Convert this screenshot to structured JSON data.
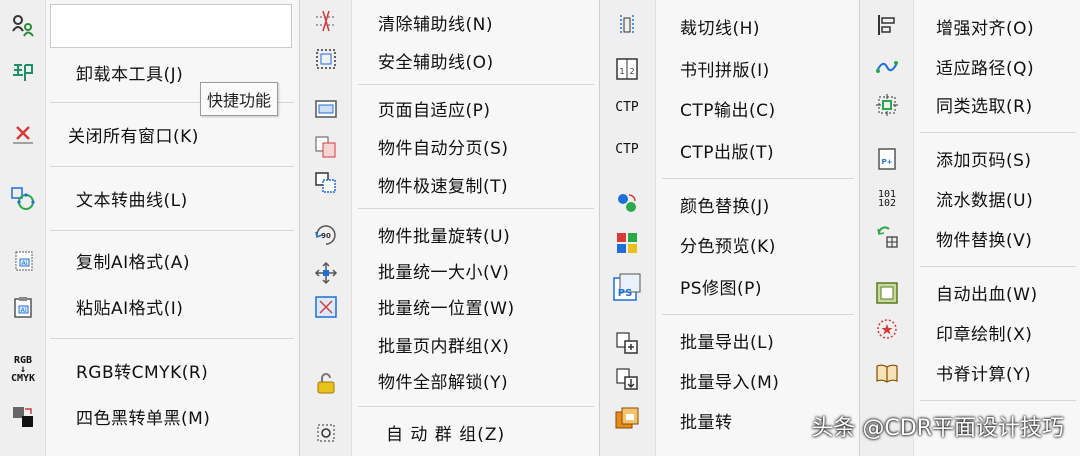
{
  "panel1": {
    "items": [
      {
        "label": "卸载本工具(J)"
      },
      {
        "label": "关闭所有窗口(K)"
      },
      {
        "label": "文本转曲线(L)"
      },
      {
        "label": "复制AI格式(A)"
      },
      {
        "label": "粘贴AI格式(I)"
      },
      {
        "label": "RGB转CMYK(R)"
      },
      {
        "label": "四色黑转单黑(M)"
      }
    ],
    "tooltip": "快捷功能",
    "rgb_icon_text": [
      "RGB",
      "↓",
      "CMYK"
    ]
  },
  "panel2": {
    "items": [
      {
        "label": "清除辅助线(N)"
      },
      {
        "label": "安全辅助线(O)"
      },
      {
        "label": "页面自适应(P)"
      },
      {
        "label": "物件自动分页(S)"
      },
      {
        "label": "物件极速复制(T)"
      },
      {
        "label": "物件批量旋转(U)"
      },
      {
        "label": "批量统一大小(V)"
      },
      {
        "label": "批量统一位置(W)"
      },
      {
        "label": "批量页内群组(X)"
      },
      {
        "label": "物件全部解锁(Y)"
      },
      {
        "label": "自 动 群 组(Z)"
      }
    ]
  },
  "panel3": {
    "items": [
      {
        "label": "裁切线(H)"
      },
      {
        "label": "书刊拼版(I)"
      },
      {
        "label": "CTP输出(C)"
      },
      {
        "label": "CTP出版(T)"
      },
      {
        "label": "颜色替换(J)"
      },
      {
        "label": "分色预览(K)"
      },
      {
        "label": "PS修图(P)"
      },
      {
        "label": "批量导出(L)"
      },
      {
        "label": "批量导入(M)"
      },
      {
        "label": "批量转"
      }
    ],
    "ctp_icon_text": "CTP",
    "ps_icon_text": "PS"
  },
  "panel4": {
    "items": [
      {
        "label": "增强对齐(O)"
      },
      {
        "label": "适应路径(Q)"
      },
      {
        "label": "同类选取(R)"
      },
      {
        "label": "添加页码(S)"
      },
      {
        "label": "流水数据(U)"
      },
      {
        "label": "物件替换(V)"
      },
      {
        "label": "自动出血(W)"
      },
      {
        "label": "印章绘制(X)"
      },
      {
        "label": "书脊计算(Y)"
      }
    ],
    "number_icon_text": [
      "101",
      "102"
    ]
  },
  "watermark": "头条 @CDR平面设计技巧",
  "colors": {
    "icon_blue": "#1e6fd9",
    "icon_green": "#2aa84a",
    "icon_red": "#d83a3a",
    "icon_orange": "#e88a1a",
    "icon_yellow": "#e8c21a"
  }
}
